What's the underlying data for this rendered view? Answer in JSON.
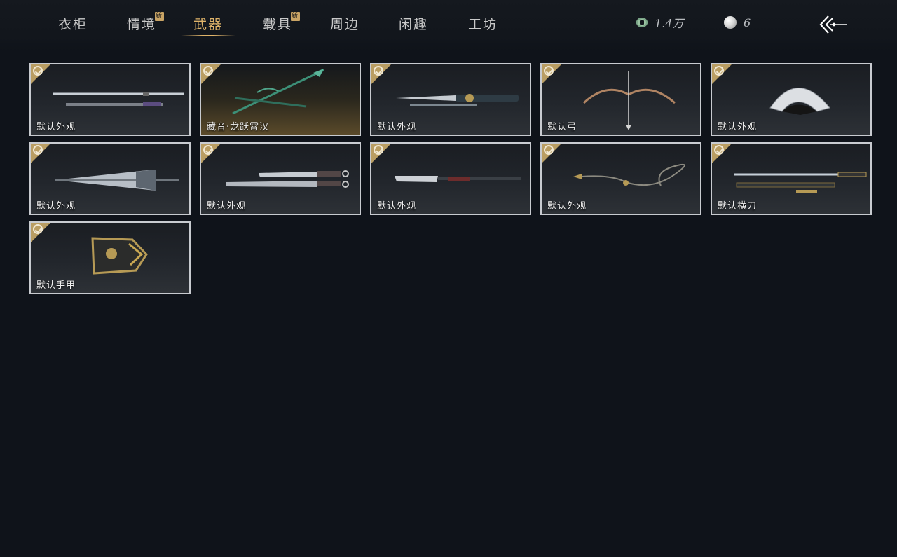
{
  "tabs": [
    {
      "label": "衣柜",
      "new": false,
      "active": false
    },
    {
      "label": "情境",
      "new": true,
      "active": false
    },
    {
      "label": "武器",
      "new": false,
      "active": true
    },
    {
      "label": "载具",
      "new": true,
      "active": false
    },
    {
      "label": "周边",
      "new": false,
      "active": false
    },
    {
      "label": "闲趣",
      "new": false,
      "active": false
    },
    {
      "label": "工坊",
      "new": false,
      "active": false
    }
  ],
  "new_badge": "新",
  "currency": {
    "coins": {
      "icon": "jade-coin-icon",
      "value": "1.4万"
    },
    "pearls": {
      "icon": "pearl-icon",
      "value": "6"
    }
  },
  "back": {
    "icon": "back-arrow-icon"
  },
  "colors": {
    "accent": "#e0b46a",
    "check": "#b99d62",
    "background": "#0f131a"
  },
  "items": [
    {
      "label": "默认外观",
      "weapon": "sword-icon",
      "owned": true
    },
    {
      "label": "藏音·龙跃霄汉",
      "weapon": "spear-icon",
      "owned": true
    },
    {
      "label": "默认外观",
      "weapon": "dual-blade-icon",
      "owned": true
    },
    {
      "label": "默认弓",
      "weapon": "bow-icon",
      "owned": true
    },
    {
      "label": "默认外观",
      "weapon": "fan-icon",
      "owned": true
    },
    {
      "label": "默认外观",
      "weapon": "umbrella-icon",
      "owned": true
    },
    {
      "label": "默认外观",
      "weapon": "twin-swords-icon",
      "owned": true
    },
    {
      "label": "默认外观",
      "weapon": "glaive-icon",
      "owned": true
    },
    {
      "label": "默认外观",
      "weapon": "rope-dart-icon",
      "owned": true
    },
    {
      "label": "默认横刀",
      "weapon": "hengdao-icon",
      "owned": true
    },
    {
      "label": "默认手甲",
      "weapon": "gauntlet-icon",
      "owned": true
    }
  ]
}
